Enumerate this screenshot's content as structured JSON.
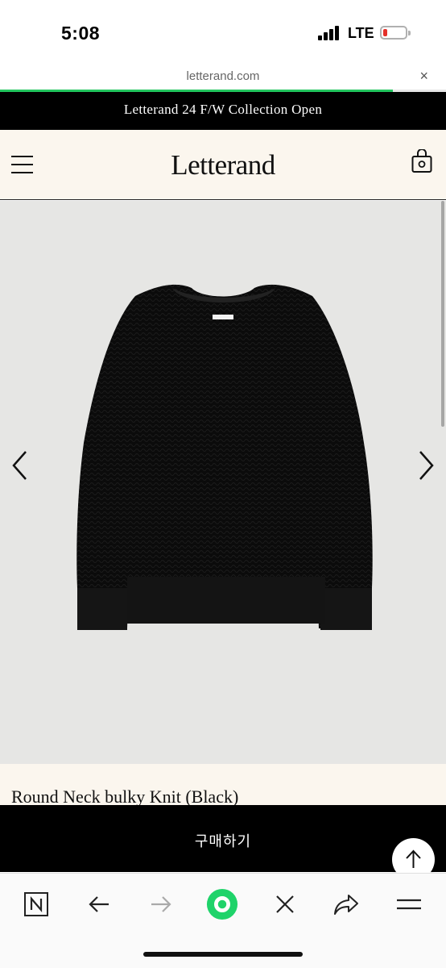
{
  "status_bar": {
    "time": "5:08",
    "network": "LTE"
  },
  "browser": {
    "url": "letterand.com",
    "close_glyph": "×",
    "load_progress_percent": 88
  },
  "announcement": {
    "text": "Letterand 24 F/W Collection Open"
  },
  "header": {
    "logo": "Letterand",
    "menu_icon": "hamburger-icon",
    "cart_icon": "shopping-bag-icon"
  },
  "product": {
    "title": "Round Neck bulky Knit (Black)",
    "image_alt": "black knit sweater"
  },
  "buy_bar": {
    "label": "구매하기"
  },
  "colors": {
    "accent_green": "#22c55e",
    "header_bg": "#fbf6ee",
    "announce_bg": "#000000"
  },
  "toolbar": {
    "items": [
      "naver-n-icon",
      "back-arrow-icon",
      "forward-arrow-icon",
      "green-circle-icon",
      "close-icon",
      "share-icon",
      "menu-lines-icon"
    ]
  }
}
